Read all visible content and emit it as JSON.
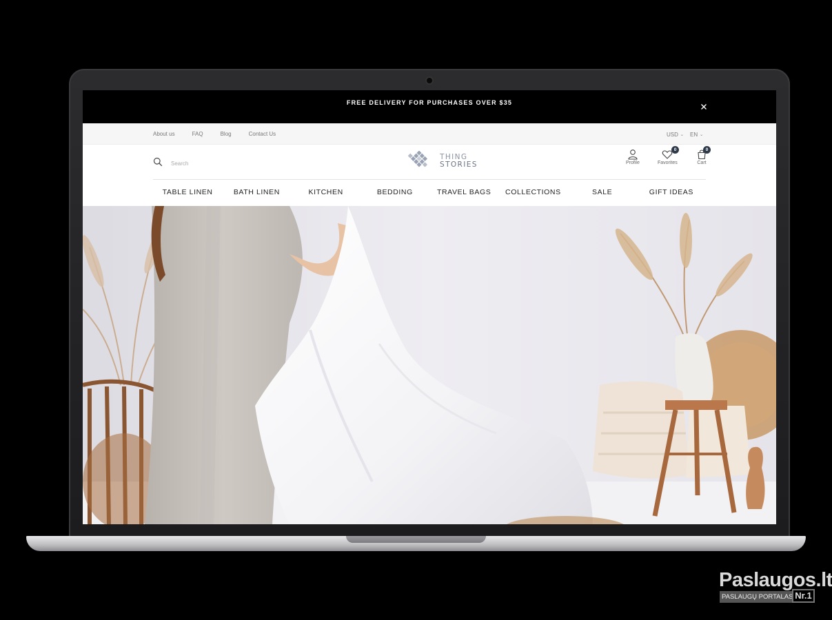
{
  "promo": {
    "text": "FREE DELIVERY FOR PURCHASES OVER $35",
    "close_icon": "close-icon"
  },
  "utility": {
    "links": [
      "About us",
      "FAQ",
      "Blog",
      "Contact Us"
    ],
    "currency": "USD",
    "language": "EN"
  },
  "search": {
    "placeholder": "Search"
  },
  "logo": {
    "line1": "THING",
    "line2": "STORIES"
  },
  "header_icons": {
    "profile_label": "Profile",
    "favorites_label": "Favorites",
    "favorites_count": "0",
    "cart_label": "Cart",
    "cart_count": "0"
  },
  "nav": [
    "TABLE LINEN",
    "BATH LINEN",
    "KITCHEN",
    "BEDDING",
    "TRAVEL BAGS",
    "COLLECTIONS",
    "SALE",
    "GIFT IDEAS"
  ],
  "watermark": {
    "title": "Paslaugos.lt",
    "subtitle": "PASLAUGŲ PORTALAS",
    "badge": "Nr.1"
  },
  "colors": {
    "promo_bg": "#000000",
    "badge_bg": "#2e3a4a",
    "logo": "#8a93a3",
    "accent_wood": "#b9774b"
  }
}
